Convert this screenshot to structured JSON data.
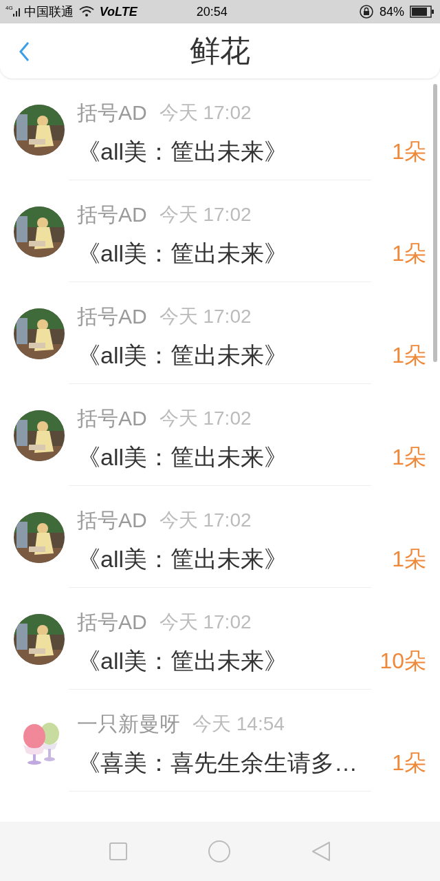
{
  "status_bar": {
    "network": "4G",
    "carrier": "中国联通",
    "volte": "VoLTE",
    "time": "20:54",
    "battery": "84%"
  },
  "header": {
    "title": "鲜花"
  },
  "rows": [
    {
      "name": "括号AD",
      "time": "今天 17:02",
      "title": "《all美：筐出未来》",
      "count": "1朵"
    },
    {
      "name": "括号AD",
      "time": "今天 17:02",
      "title": "《all美：筐出未来》",
      "count": "1朵"
    },
    {
      "name": "括号AD",
      "time": "今天 17:02",
      "title": "《all美：筐出未来》",
      "count": "1朵"
    },
    {
      "name": "括号AD",
      "time": "今天 17:02",
      "title": "《all美：筐出未来》",
      "count": "1朵"
    },
    {
      "name": "括号AD",
      "time": "今天 17:02",
      "title": "《all美：筐出未来》",
      "count": "1朵"
    },
    {
      "name": "括号AD",
      "time": "今天 17:02",
      "title": "《all美：筐出未来》",
      "count": "10朵"
    },
    {
      "name": "一只新曼呀",
      "time": "今天 14:54",
      "title": "《喜美：喜先生余生请多…",
      "count": "1朵"
    }
  ]
}
